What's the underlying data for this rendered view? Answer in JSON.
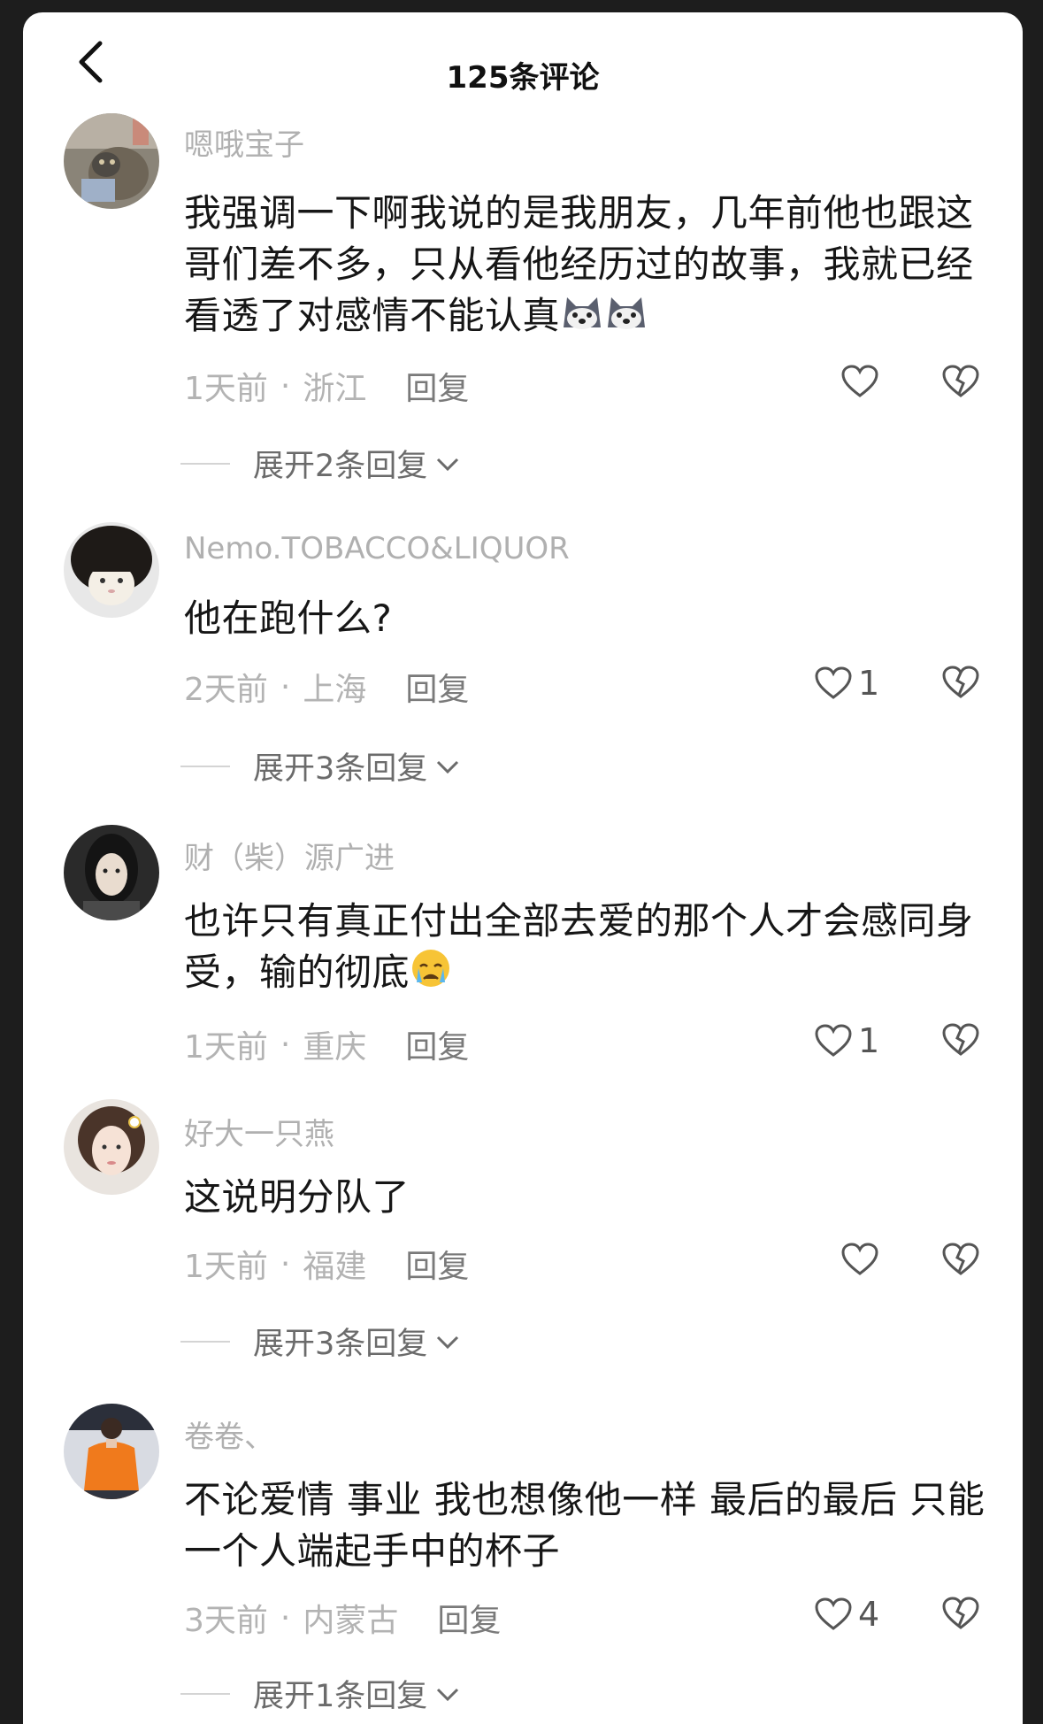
{
  "header": {
    "title": "125条评论"
  },
  "comments": [
    {
      "username": "嗯哦宝子",
      "text": "我强调一下啊我说的是我朋友，几年前他也跟这哥们差不多，只从看他经历过的故事，我就已经看透了对感情不能认真",
      "time": "1天前",
      "location": "浙江",
      "reply_label": "回复",
      "likes": "",
      "expand_label": "展开2条回复"
    },
    {
      "username": "Nemo.TOBACCO&LIQUOR",
      "text": "他在跑什么?",
      "time": "2天前",
      "location": "上海",
      "reply_label": "回复",
      "likes": "1",
      "expand_label": "展开3条回复"
    },
    {
      "username": "财（柴）源广进",
      "text": "也许只有真正付出全部去爱的那个人才会感同身受，输的彻底",
      "time": "1天前",
      "location": "重庆",
      "reply_label": "回复",
      "likes": "1",
      "expand_label": ""
    },
    {
      "username": "好大一只燕",
      "text": "这说明分队了",
      "time": "1天前",
      "location": "福建",
      "reply_label": "回复",
      "likes": "",
      "expand_label": "展开3条回复"
    },
    {
      "username": "卷卷、",
      "text": "不论爱情 事业 我也想像他一样 最后的最后 只能一个人端起手中的杯子",
      "time": "3天前",
      "location": "内蒙古",
      "reply_label": "回复",
      "likes": "4",
      "expand_label": "展开1条回复"
    }
  ],
  "meta_separator": "·",
  "icons": {
    "back": "chevron-left-icon",
    "like": "heart-outline-icon",
    "dislike": "broken-heart-icon",
    "expand": "chevron-down-icon",
    "emoji_1": "husky-face-emoji",
    "emoji_3": "crying-face-emoji"
  },
  "colors": {
    "username": "#b0b0b0",
    "text": "#161616",
    "meta": "#b3b3b3",
    "reply": "#7a7a7a"
  }
}
